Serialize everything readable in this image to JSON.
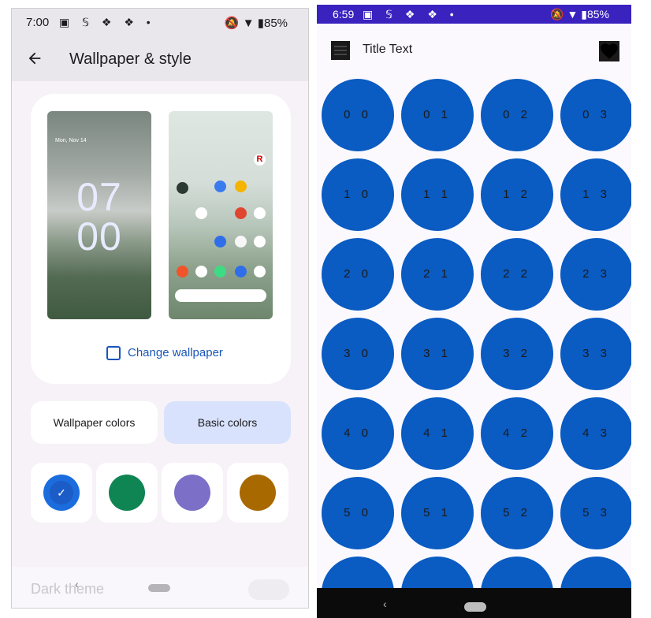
{
  "left": {
    "status": {
      "time": "7:00",
      "icons": "▣ 𝕊 ❖ ❖ •",
      "right": "🔕 ▼ ▮85%"
    },
    "appbar": {
      "back": "←",
      "title": "Wallpaper & style"
    },
    "lock_preview": {
      "date": "Mon, Nov 14",
      "hour": "07",
      "minute": "00"
    },
    "change_wallpaper": "Change wallpaper",
    "tabs": [
      "Wallpaper colors",
      "Basic colors"
    ],
    "swatches": [
      {
        "color": "#1b6ddd",
        "selected": true,
        "check": "✓"
      },
      {
        "color": "#0e8553"
      },
      {
        "color": "#7b6fc7"
      },
      {
        "color": "#a86900"
      }
    ],
    "bottom": {
      "dark_theme": "Dark theme",
      "nav_back": "‹"
    }
  },
  "right": {
    "status": {
      "time": "6:59",
      "icons": "▣ 𝕊 ❖ ❖ •",
      "right": "🔕 ▼ ▮85%"
    },
    "appbar": {
      "title": "Title Text"
    },
    "grid": [
      [
        "0 0",
        "0 1",
        "0 2",
        "0 3"
      ],
      [
        "1 0",
        "1 1",
        "1 2",
        "1 3"
      ],
      [
        "2 0",
        "2 1",
        "2 2",
        "2 3"
      ],
      [
        "3 0",
        "3 1",
        "3 2",
        "3 3"
      ],
      [
        "4 0",
        "4 1",
        "4 2",
        "4 3"
      ],
      [
        "5 0",
        "5 1",
        "5 2",
        "5 3"
      ],
      [
        "",
        "",
        "",
        ""
      ]
    ],
    "nav_back": "‹"
  }
}
